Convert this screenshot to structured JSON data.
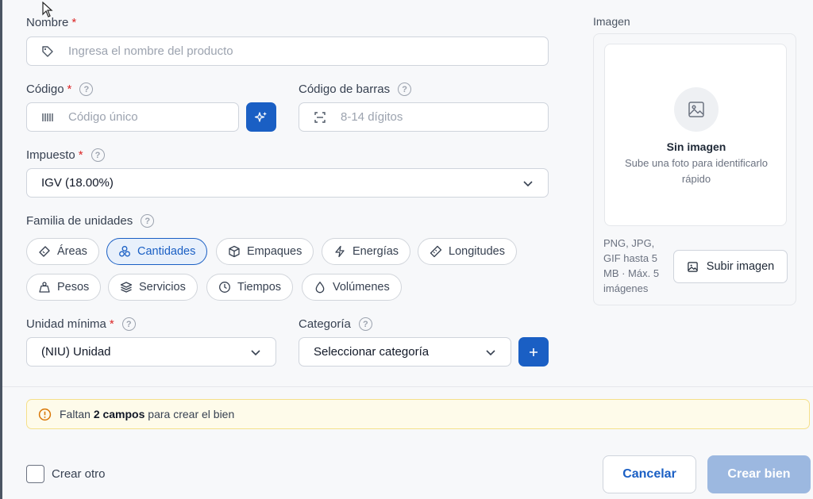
{
  "form": {
    "nombre": {
      "label": "Nombre",
      "required": "*",
      "placeholder": "Ingresa el nombre del producto"
    },
    "codigo": {
      "label": "Código",
      "required": "*",
      "help": "?",
      "placeholder": "Código único"
    },
    "codigo_barras": {
      "label": "Código de barras",
      "help": "?",
      "placeholder": "8-14 dígitos"
    },
    "impuesto": {
      "label": "Impuesto",
      "required": "*",
      "help": "?",
      "value": "IGV (18.00%)"
    },
    "familia": {
      "label": "Familia de unidades",
      "help": "?",
      "chips": [
        {
          "label": "Áreas",
          "icon": "tag-icon"
        },
        {
          "label": "Cantidades",
          "icon": "cubes-icon",
          "active": true
        },
        {
          "label": "Empaques",
          "icon": "box-icon"
        },
        {
          "label": "Energías",
          "icon": "bolt-icon"
        },
        {
          "label": "Longitudes",
          "icon": "ruler-icon"
        },
        {
          "label": "Pesos",
          "icon": "weight-icon"
        },
        {
          "label": "Servicios",
          "icon": "layers-icon"
        },
        {
          "label": "Tiempos",
          "icon": "clock-icon"
        },
        {
          "label": "Volúmenes",
          "icon": "droplet-icon"
        }
      ]
    },
    "unidad_minima": {
      "label": "Unidad mínima",
      "required": "*",
      "help": "?",
      "value": "(NIU) Unidad"
    },
    "categoria": {
      "label": "Categoría",
      "help": "?",
      "value": "Seleccionar categoría"
    }
  },
  "image": {
    "label": "Imagen",
    "empty_title": "Sin imagen",
    "empty_sub": "Sube una foto para identificarlo rápido",
    "formats": "PNG, JPG, GIF hasta 5 MB · Máx. 5 imágenes",
    "upload_label": "Subir imagen"
  },
  "warning": {
    "prefix": "Faltan",
    "count": "2 campos",
    "suffix": "para crear el bien"
  },
  "footer": {
    "crear_otro": "Crear otro",
    "cancel": "Cancelar",
    "create": "Crear bien"
  },
  "colors": {
    "accent": "#1a5fc4",
    "warning_bg": "#fefbea",
    "required": "#dc2626"
  }
}
